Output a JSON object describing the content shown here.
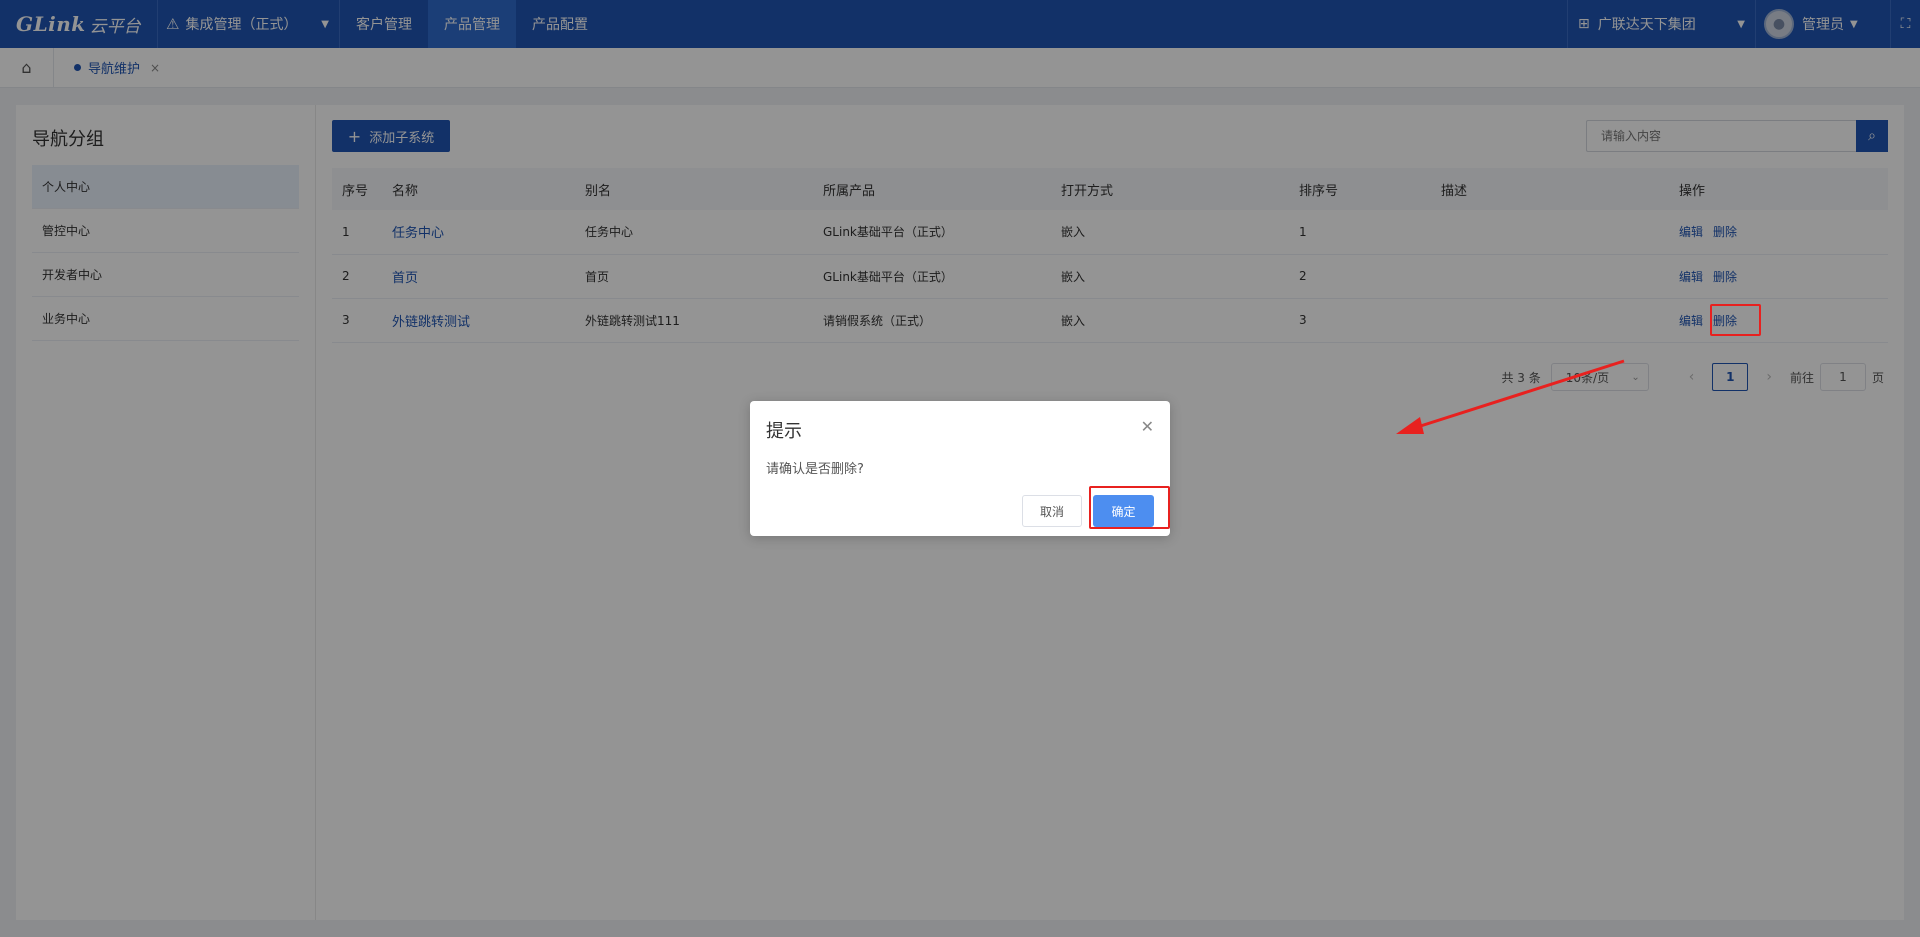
{
  "topbar": {
    "logo_brand": "GLink",
    "logo_sub": "云平台",
    "system": "集成管理（正式）",
    "nav": [
      "客户管理",
      "产品管理",
      "产品配置"
    ],
    "org": "广联达天下集团",
    "user": "管理员"
  },
  "tabbar": {
    "tab_label": "导航维护"
  },
  "sidebar": {
    "title": "导航分组",
    "items": [
      "个人中心",
      "管控中心",
      "开发者中心",
      "业务中心"
    ]
  },
  "toolbar": {
    "add_label": "添加子系统",
    "search_placeholder": "请输入内容"
  },
  "table": {
    "headers": [
      "序号",
      "名称",
      "别名",
      "所属产品",
      "打开方式",
      "排序号",
      "描述",
      "操作"
    ],
    "rows": [
      {
        "no": "1",
        "name": "任务中心",
        "alias": "任务中心",
        "product": "GLink基础平台（正式）",
        "open": "嵌入",
        "order": "1",
        "desc": ""
      },
      {
        "no": "2",
        "name": "首页",
        "alias": "首页",
        "product": "GLink基础平台（正式）",
        "open": "嵌入",
        "order": "2",
        "desc": ""
      },
      {
        "no": "3",
        "name": "外链跳转测试",
        "alias": "外链跳转测试111",
        "product": "请销假系统（正式）",
        "open": "嵌入",
        "order": "3",
        "desc": ""
      }
    ],
    "edit_label": "编辑",
    "delete_label": "删除"
  },
  "pager": {
    "total": "共 3 条",
    "page_size": "10条/页",
    "current": "1",
    "goto_prefix": "前往",
    "goto_value": "1",
    "goto_suffix": "页"
  },
  "dialog": {
    "title": "提示",
    "message": "请确认是否删除?",
    "cancel_label": "取消",
    "ok_label": "确定"
  },
  "colors": {
    "primary": "#1f55b3",
    "annotation": "#e8211f"
  }
}
